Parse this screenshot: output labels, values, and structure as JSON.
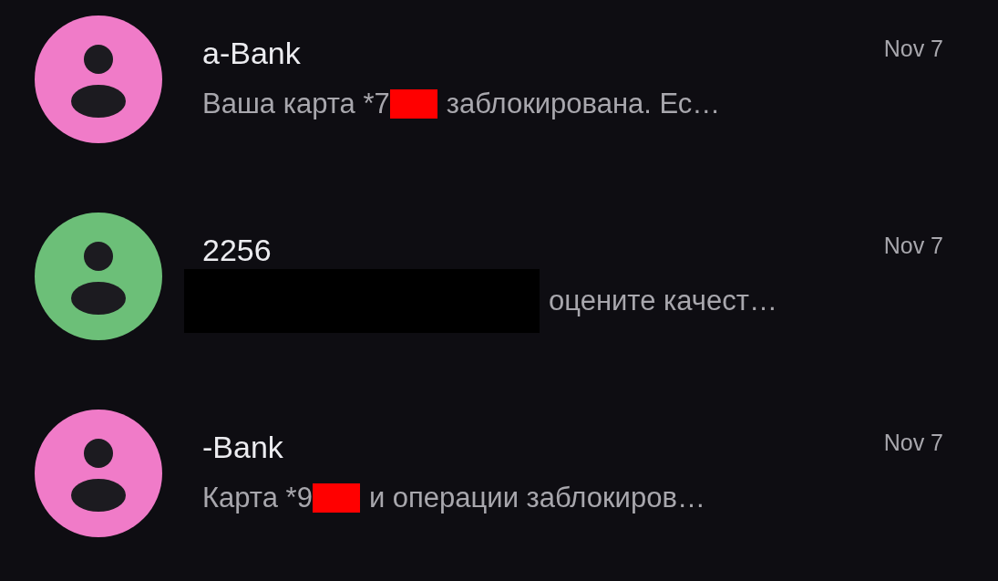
{
  "conversations": [
    {
      "color": "#f07bc8",
      "title": "a-Bank",
      "date": "Nov 7",
      "preview": {
        "before": "Ваша карта *7",
        "redaction": {
          "kind": "short",
          "color": "#ff0000"
        },
        "after": "заблокирована. Ес…"
      }
    },
    {
      "color": "#6cbf78",
      "title": "2256",
      "date": "Nov 7",
      "preview": {
        "redaction": {
          "kind": "long",
          "color": "#000000"
        },
        "after": "оцените качест…"
      }
    },
    {
      "color": "#f07bc8",
      "title": "-Bank",
      "date": "Nov 7",
      "preview": {
        "before": "Карта *9",
        "redaction": {
          "kind": "short",
          "color": "#ff0000"
        },
        "after": "и операции заблокиров…"
      }
    }
  ]
}
